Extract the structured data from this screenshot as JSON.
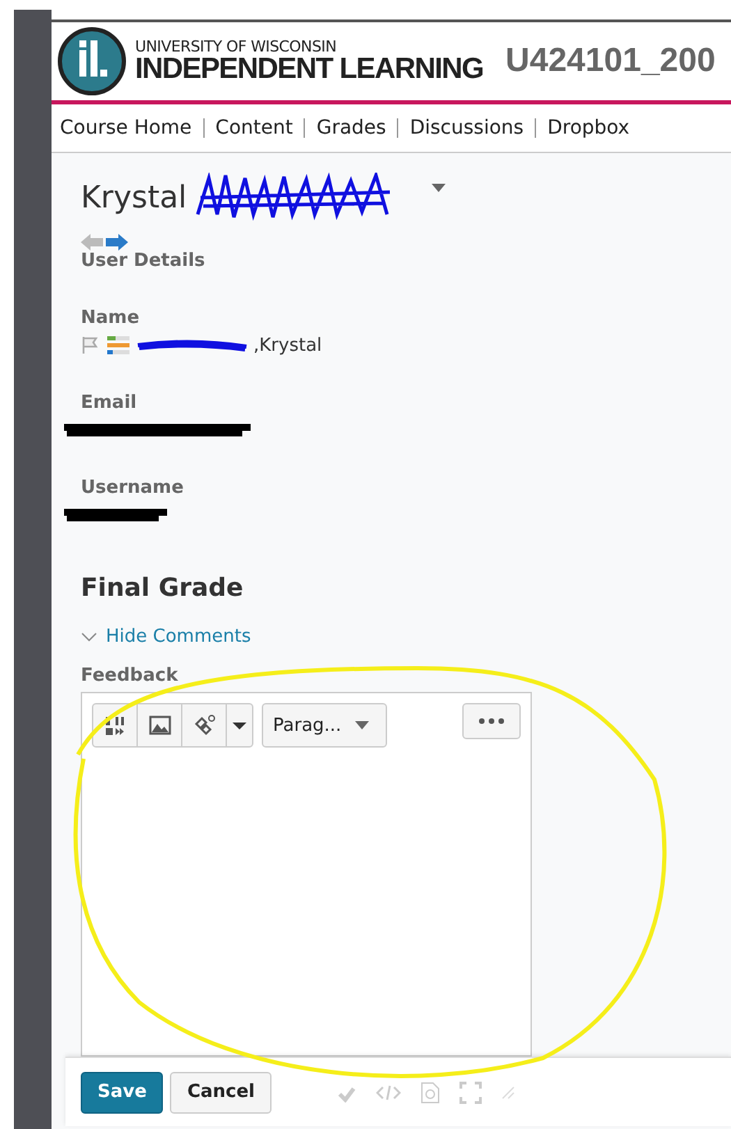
{
  "header": {
    "logo_small": "UNIVERSITY OF WISCONSIN",
    "logo_large": "INDEPENDENT LEARNING",
    "course_code": "U424101_200"
  },
  "nav": [
    {
      "label": "Course Home"
    },
    {
      "label": "Content"
    },
    {
      "label": "Grades"
    },
    {
      "label": "Discussions"
    },
    {
      "label": "Dropbox"
    }
  ],
  "user": {
    "first_name": "Krystal",
    "section_title": "User Details",
    "fields": [
      {
        "label": "Name",
        "value": ",Krystal"
      },
      {
        "label": "Email"
      },
      {
        "label": "Username"
      }
    ]
  },
  "grade": {
    "title": "Final Grade",
    "toggle": "Hide Comments",
    "feedback_label": "Feedback",
    "format": "Parag..."
  },
  "buttons": [
    {
      "label": "Save",
      "kind": "primary"
    },
    {
      "label": "Cancel",
      "kind": "secondary"
    }
  ]
}
